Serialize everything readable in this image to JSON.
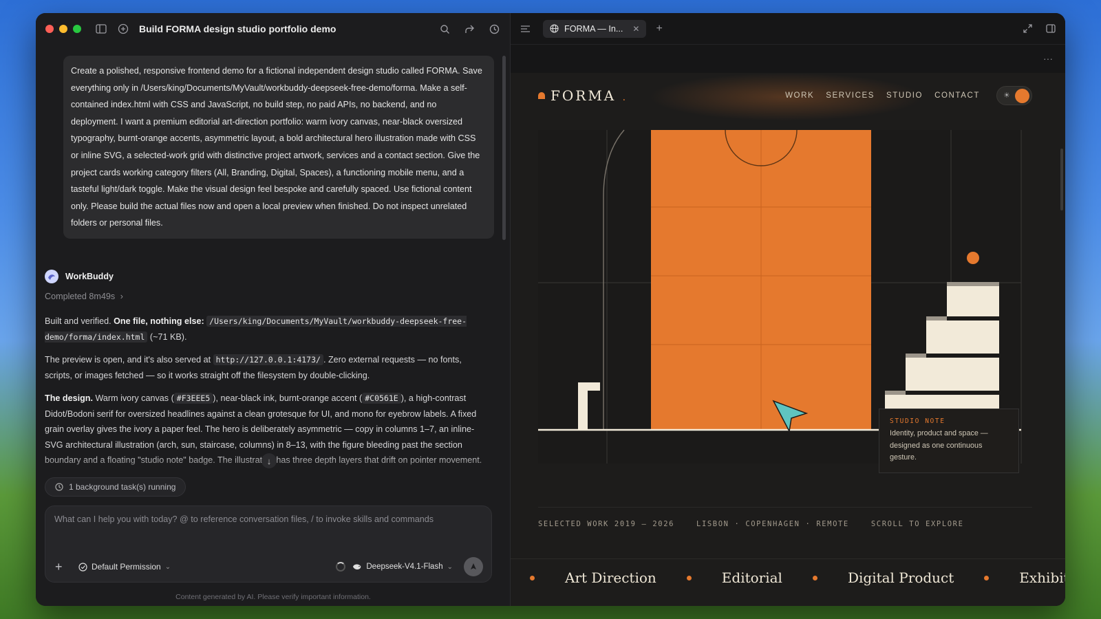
{
  "chat": {
    "title": "Build FORMA design studio portfolio demo",
    "user_prompt": "Create a polished, responsive frontend demo for a fictional independent design studio called FORMA. Save everything only in /Users/king/Documents/MyVault/workbuddy-deepseek-free-demo/forma. Make a self-contained index.html with CSS and JavaScript, no build step, no paid APIs, no backend, and no deployment. I want a premium editorial art-direction portfolio: warm ivory canvas, near-black oversized typography, burnt-orange accents, asymmetric layout, a bold architectural hero illustration made with CSS or inline SVG, a selected-work grid with distinctive project artwork, services and a contact section. Give the project cards working category filters (All, Branding, Digital, Spaces), a functioning mobile menu, and a tasteful light/dark toggle. Make the visual design feel bespoke and carefully spaced. Use fictional content only. Please build the actual files now and open a local preview when finished. Do not inspect unrelated folders or personal files.",
    "agent_name": "WorkBuddy",
    "completed": "Completed 8m49s",
    "msg1": {
      "a": "Built and verified. ",
      "b": "One file, nothing else:",
      "path": "/Users/king/Documents/MyVault/workbuddy-deepseek-free-demo/forma/index.html",
      "size": "(~71 KB)."
    },
    "msg2": {
      "a": "The preview is open, and it's also served at",
      "url": "http://127.0.0.1:4173/",
      "b": ". Zero external requests — no fonts, scripts, or images fetched — so it works straight off the filesystem by double-clicking."
    },
    "msg3": {
      "lead": "The design.",
      "a": " Warm ivory canvas (",
      "c1": "#F3EEE5",
      "b": "), near-black ink, burnt-orange accent (",
      "c2": "#C0561E",
      "c": "), a high-contrast Didot/Bodoni serif for oversized headlines against a clean grotesque for UI, and mono for eyebrow labels. A fixed grain overlay gives the ivory a paper feel. The hero is deliberately asymmetric — copy in columns 1–7, an inline-SVG architectural illustration (arch, sun, staircase, columns) in 8–13, with the figure bleeding past the section boundary and a floating \"studio note\" badge. The illustration has three depth layers that drift on pointer movement."
    },
    "bg_task": "1 background task(s) running",
    "composer_placeholder": "What can I help you with today? @ to reference conversation files, / to invoke skills and commands",
    "permission": "Default Permission",
    "model": "Deepseek-V4.1-Flash",
    "disclaimer": "Content generated by AI. Please verify important information."
  },
  "browser": {
    "tab_title": "FORMA — In...",
    "more": "···"
  },
  "site": {
    "logo": "FORMA",
    "logo_suffix": ".",
    "nav": [
      "WORK",
      "SERVICES",
      "STUDIO",
      "CONTACT"
    ],
    "note_title": "STUDIO NOTE",
    "note_text": "Identity, product and space — designed as one continuous gesture.",
    "meta": [
      "SELECTED WORK 2019 — 2026",
      "LISBON · COPENHAGEN · REMOTE",
      "SCROLL TO EXPLORE"
    ],
    "marquee": [
      "Art Direction",
      "Editorial",
      "Digital Product",
      "Exhibition I"
    ]
  },
  "colors": {
    "accent": "#e5792e",
    "ivory": "#f2ead9",
    "dark": "#1d1c1b"
  },
  "icons": [
    "sidebar-icon",
    "new-chat-icon",
    "search-icon",
    "share-icon",
    "history-icon",
    "list-icon",
    "globe-icon",
    "expand-icon",
    "panel-icon",
    "clock-icon",
    "shield-check-icon",
    "whale-icon",
    "send-icon",
    "sun-icon"
  ]
}
